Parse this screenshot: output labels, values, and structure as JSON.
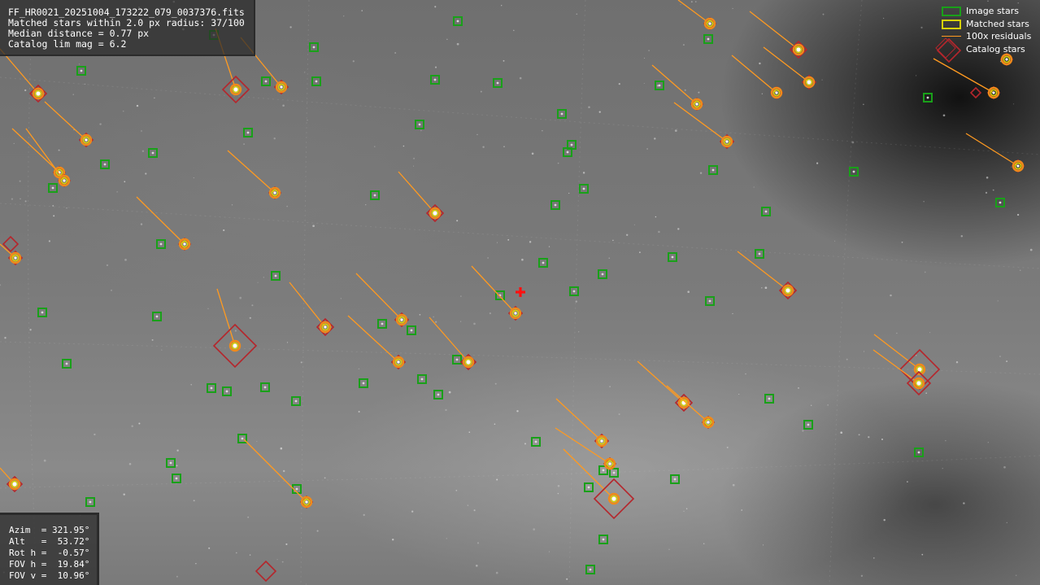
{
  "info_top": {
    "filename": "FF_HR0021_20251004_173222_079_0037376.fits",
    "matched_line": "Matched stars within 2.0 px radius: 37/100",
    "median_line": "Median distance = 0.77 px",
    "catalog_line": "Catalog lim mag = 6.2"
  },
  "info_bottom": {
    "azim": "Azim  = 321.95°",
    "alt": "Alt   =  53.72°",
    "rot": "Rot h =  -0.57°",
    "fov_h": "FOV h =  19.84°",
    "fov_v": "FOV v =  10.96°"
  },
  "legend": {
    "image_stars": "Image stars",
    "matched_stars": "Matched stars",
    "residuals": "100x residuals",
    "catalog_stars": "Catalog stars"
  },
  "colors": {
    "image_star": "#19a019",
    "matched_outer": "#f08a1a",
    "matched_inner": "#d7d20a",
    "residual": "#ff9a20",
    "catalog": "#b5262c",
    "center_cross": "#ff1010"
  },
  "icons": {
    "center_marker": "red-plus-cross-icon"
  }
}
